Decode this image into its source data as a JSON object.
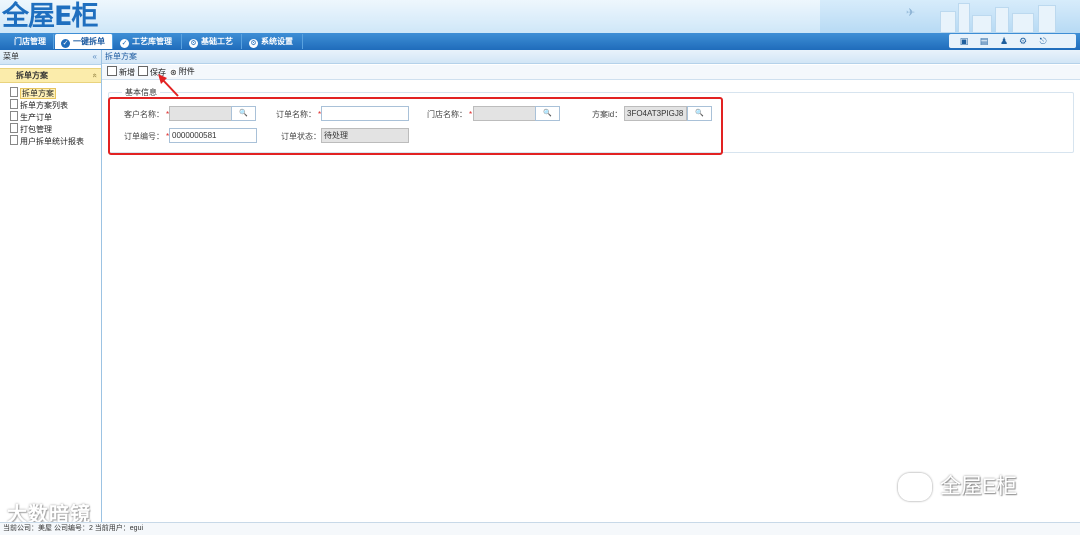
{
  "app": {
    "logo_text": "全屋E柜"
  },
  "nav": {
    "tabs": [
      {
        "label": "门店管理",
        "icon": "none"
      },
      {
        "label": "一键拆单",
        "icon": "check-circle-icon",
        "active": true
      },
      {
        "label": "工艺库管理",
        "icon": "check-circle-icon"
      },
      {
        "label": "基础工艺",
        "icon": "gear-circle-icon"
      },
      {
        "label": "系统设置",
        "icon": "gear-circle-icon"
      }
    ],
    "tools": [
      "screen-icon",
      "calendar-icon",
      "user-icon",
      "gear-icon",
      "logout-icon"
    ]
  },
  "sidebar": {
    "header": "菜单",
    "collapse_glyph": "«",
    "group_label": "拆单方案",
    "group_caret": "«",
    "items": [
      {
        "label": "拆单方案",
        "active": true
      },
      {
        "label": "拆单方案列表"
      },
      {
        "label": "生产订单"
      },
      {
        "label": "打包管理"
      },
      {
        "label": "用户拆单统计报表"
      }
    ]
  },
  "content": {
    "title": "拆单方案",
    "toolbar": {
      "new_label": "新增",
      "save_label": "保存",
      "attach_label": "附件"
    },
    "section_title": "基本信息",
    "form": {
      "customer_label": "客户名称：",
      "customer_value": "",
      "order_name_label": "订单名称：",
      "order_name_value": "",
      "store_label": "门店名称：",
      "store_value": "",
      "plan_id_label": "方案id：",
      "plan_id_value": "3FO4AT3PIGJ8",
      "order_no_label": "订单编号：",
      "order_no_value": "0000000581",
      "order_status_label": "订单状态：",
      "order_status_value": "待处理",
      "required_mark": "*",
      "search_glyph": "🔍"
    }
  },
  "annotation": {
    "color": "#e22222"
  },
  "statusbar": {
    "text": "当前公司：美屋    公司编号：2    当前用户：egui"
  },
  "watermarks": {
    "left": "大数暗镜",
    "right": "全屋E柜"
  }
}
